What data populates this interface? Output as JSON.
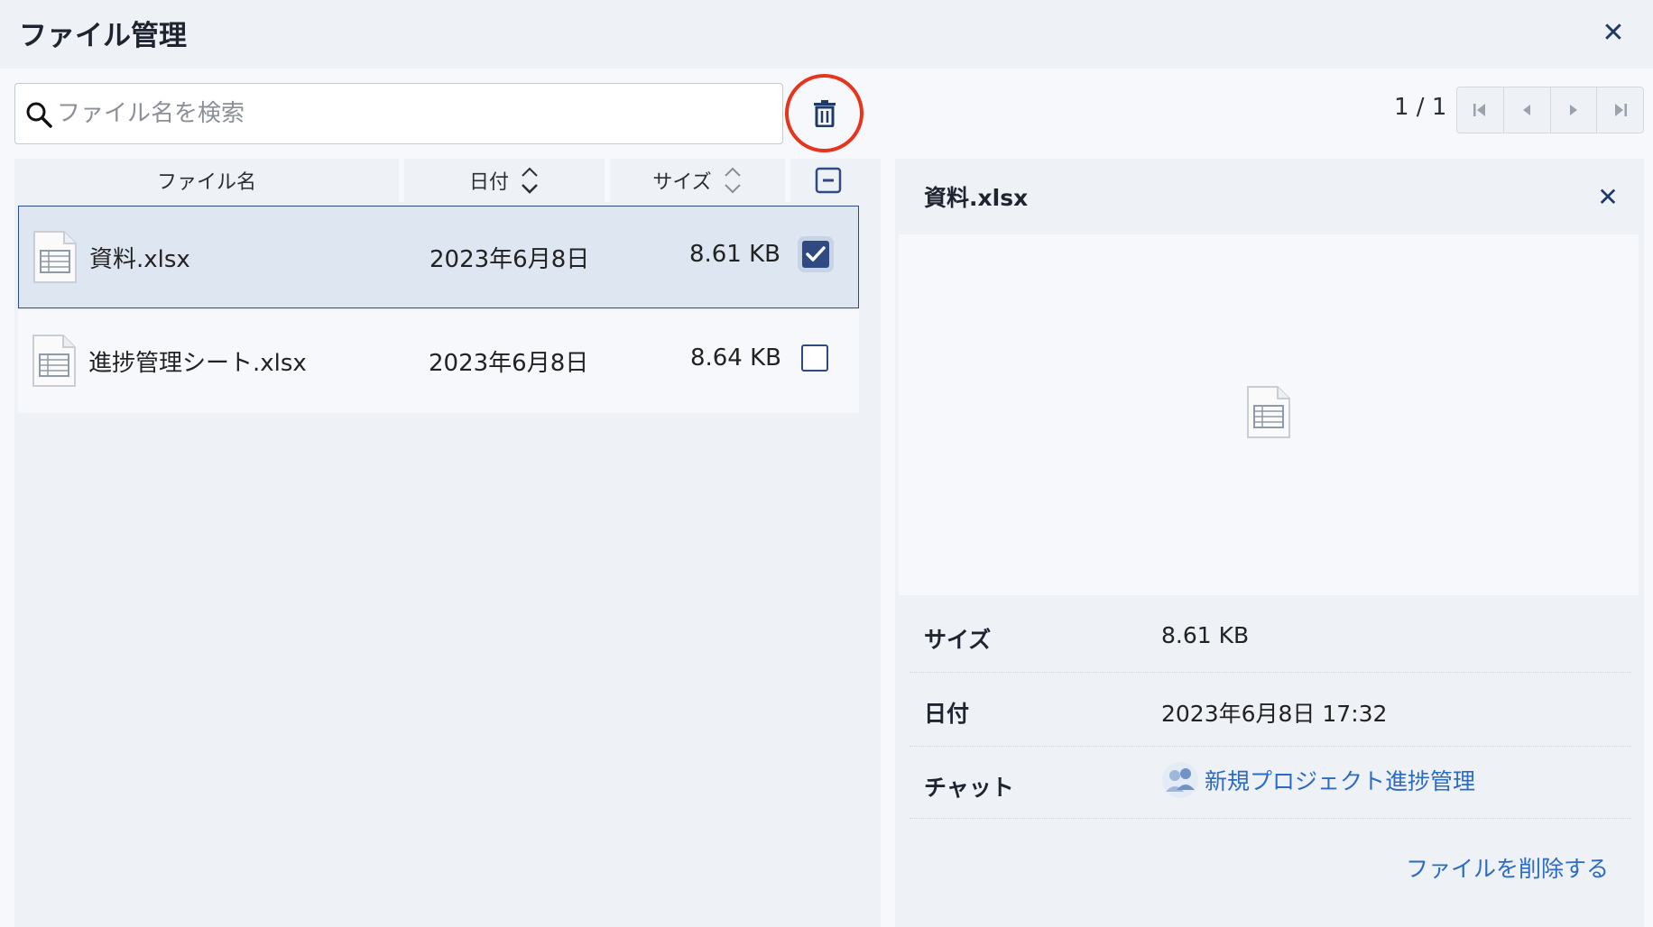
{
  "header": {
    "title": "ファイル管理",
    "close_icon": "close-icon"
  },
  "toolbar": {
    "search_placeholder": "ファイル名を検索",
    "search_icon": "search-icon",
    "delete_icon": "trash-icon",
    "highlight_color": "#e8341c"
  },
  "pagination": {
    "info": "1 / 1",
    "buttons": [
      "first-page-icon",
      "prev-page-icon",
      "next-page-icon",
      "last-page-icon"
    ]
  },
  "table": {
    "headers": {
      "name": "ファイル名",
      "date": "日付",
      "size": "サイズ"
    },
    "rows": [
      {
        "name": "資料.xlsx",
        "date": "2023年6月8日",
        "size": "8.61 KB",
        "checked": true,
        "selected": true
      },
      {
        "name": "進捗管理シート.xlsx",
        "date": "2023年6月8日",
        "size": "8.64 KB",
        "checked": false,
        "selected": false
      }
    ]
  },
  "detail": {
    "title": "資料.xlsx",
    "size_label": "サイズ",
    "size_value": "8.61 KB",
    "date_label": "日付",
    "date_value": "2023年6月8日 17:32",
    "chat_label": "チャット",
    "chat_value": "新規プロジェクト進捗管理",
    "delete_label": "ファイルを削除する"
  },
  "colors": {
    "accent": "#2f4a80",
    "link": "#2b6bc4"
  }
}
